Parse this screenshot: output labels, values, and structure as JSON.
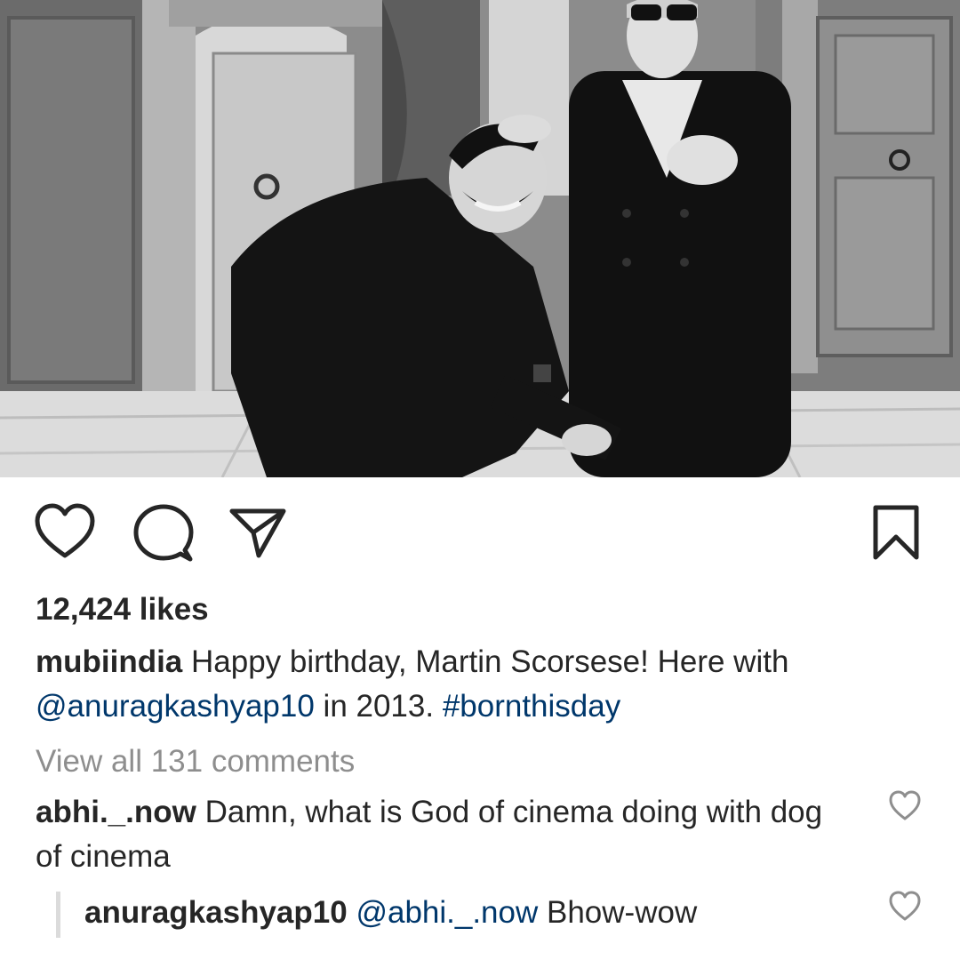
{
  "post": {
    "likes_text": "12,424 likes",
    "caption": {
      "username": "mubiindia",
      "text_part1": " Happy birthday, Martin Scorsese! Here with ",
      "mention": "@anuragkashyap10",
      "text_part2": " in 2013. ",
      "hashtag": "#bornthisday"
    },
    "view_all_comments": "View all 131 comments"
  },
  "comments": [
    {
      "username": "abhi._.now",
      "text": " Damn, what is God of cinema doing with dog of cinema"
    }
  ],
  "replies": [
    {
      "username": "anuragkashyap10",
      "mention": " @abhi._.now",
      "text": " Bhow-wow"
    }
  ],
  "icons": {
    "like": "heart-icon",
    "comment": "comment-bubble-icon",
    "share": "paper-plane-icon",
    "save": "bookmark-icon",
    "comment_like": "heart-icon"
  },
  "colors": {
    "text": "#262626",
    "link": "#00376b",
    "muted": "#8e8e8e",
    "reply_bar": "#dbdbdb"
  }
}
